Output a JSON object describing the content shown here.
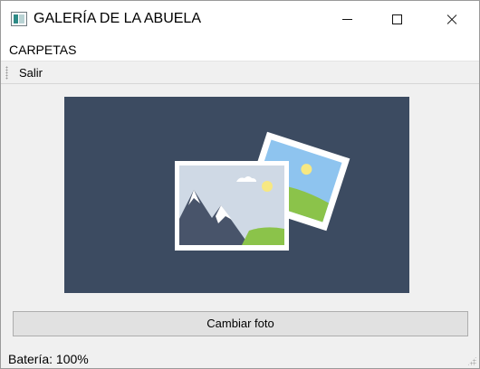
{
  "window": {
    "title": "GALERÍA DE LA ABUELA"
  },
  "menu": {
    "items": [
      "CARPETAS"
    ]
  },
  "toolbar": {
    "exit_label": "Salir"
  },
  "photo": {
    "icon": "picture-placeholder-icon",
    "background_color": "#3c4b61"
  },
  "actions": {
    "change_photo_label": "Cambiar foto"
  },
  "status": {
    "battery_text": "Batería: 100%"
  }
}
